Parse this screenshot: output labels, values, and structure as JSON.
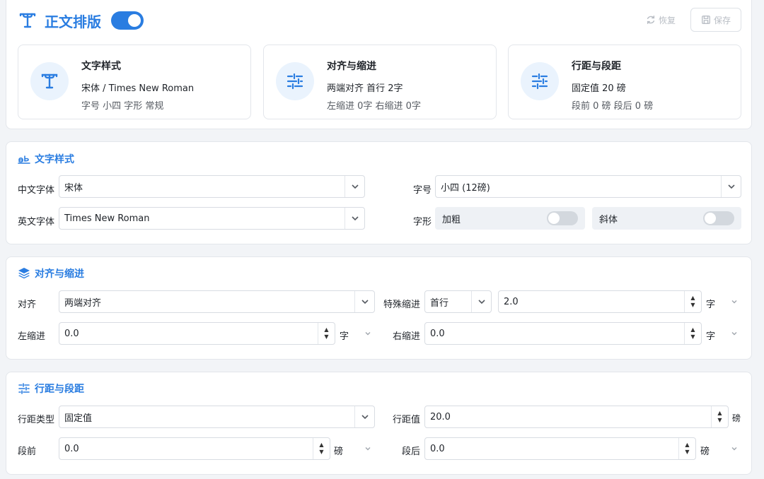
{
  "header": {
    "title": "正文排版",
    "enabled": true,
    "restore_label": "恢复",
    "save_label": "保存"
  },
  "summary": [
    {
      "icon": "typography-icon",
      "title": "文字样式",
      "line1": "宋体 / Times New Roman",
      "line2": "字号 小四  字形 常规"
    },
    {
      "icon": "sliders-icon",
      "title": "对齐与缩进",
      "line1": "两端对齐  首行 2字",
      "line2": "左缩进 0字  右缩进 0字"
    },
    {
      "icon": "sliders-icon",
      "title": "行距与段距",
      "line1": "固定值 20 磅",
      "line2": "段前 0 磅  段后 0 磅"
    }
  ],
  "font_section": {
    "title": "文字样式",
    "cn_font_label": "中文字体",
    "cn_font_value": "宋体",
    "en_font_label": "英文字体",
    "en_font_value": "Times New Roman",
    "size_label": "字号",
    "size_value": "小四 (12磅)",
    "style_label": "字形",
    "bold_label": "加粗",
    "bold_on": false,
    "italic_label": "斜体",
    "italic_on": false
  },
  "align_section": {
    "title": "对齐与缩进",
    "align_label": "对齐",
    "align_value": "两端对齐",
    "special_label": "特殊缩进",
    "special_value": "首行",
    "special_amount": "2.0",
    "special_unit": "字",
    "left_label": "左缩进",
    "left_value": "0.0",
    "left_unit": "字",
    "right_label": "右缩进",
    "right_value": "0.0",
    "right_unit": "字"
  },
  "spacing_section": {
    "title": "行距与段距",
    "type_label": "行距类型",
    "type_value": "固定值",
    "value_label": "行距值",
    "value_value": "20.0",
    "value_unit": "磅",
    "before_label": "段前",
    "before_value": "0.0",
    "before_unit": "磅",
    "after_label": "段后",
    "after_value": "0.0",
    "after_unit": "磅"
  },
  "colors": {
    "accent": "#2a7de1",
    "border": "#e3e6eb",
    "background": "#f2f4f7"
  }
}
